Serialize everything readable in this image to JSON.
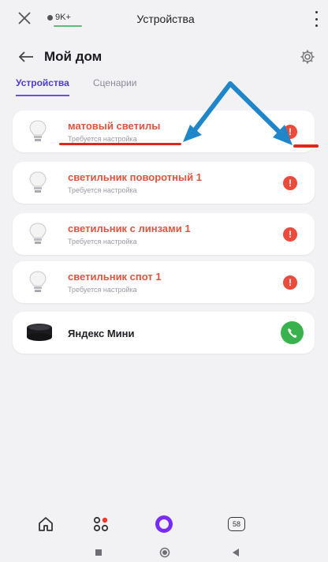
{
  "browser": {
    "chip_label": "9K+",
    "tab_title": "Устройства"
  },
  "header": {
    "title": "Мой дом"
  },
  "tabs": [
    {
      "label": "Устройства",
      "active": true
    },
    {
      "label": "Сценарии",
      "active": false
    }
  ],
  "devices": [
    {
      "name": "матовый светилы",
      "status": "Требуется настройка",
      "icon": "bulb-icon",
      "indicator": "alert-icon"
    },
    {
      "name": "светильник поворотный 1",
      "status": "Требуется настройка",
      "icon": "bulb-icon",
      "indicator": "alert-icon"
    },
    {
      "name": "светильник с линзами 1",
      "status": "Требуется настройка",
      "icon": "bulb-icon",
      "indicator": "alert-icon"
    },
    {
      "name": "светильник спот 1",
      "status": "Требуется настройка",
      "icon": "bulb-icon",
      "indicator": "alert-icon"
    },
    {
      "name": "Яндекс Мини",
      "status": "",
      "icon": "speaker-icon",
      "indicator": "phone-icon"
    }
  ],
  "bottom_nav": {
    "tabs_count": "58"
  },
  "colors": {
    "accent": "#6a4fe0",
    "warning_text": "#e0533f",
    "alert": "#ec4b3c",
    "call": "#39b24d",
    "annotation_arrow": "#1f86c9",
    "annotation_underline": "#e0271b"
  }
}
